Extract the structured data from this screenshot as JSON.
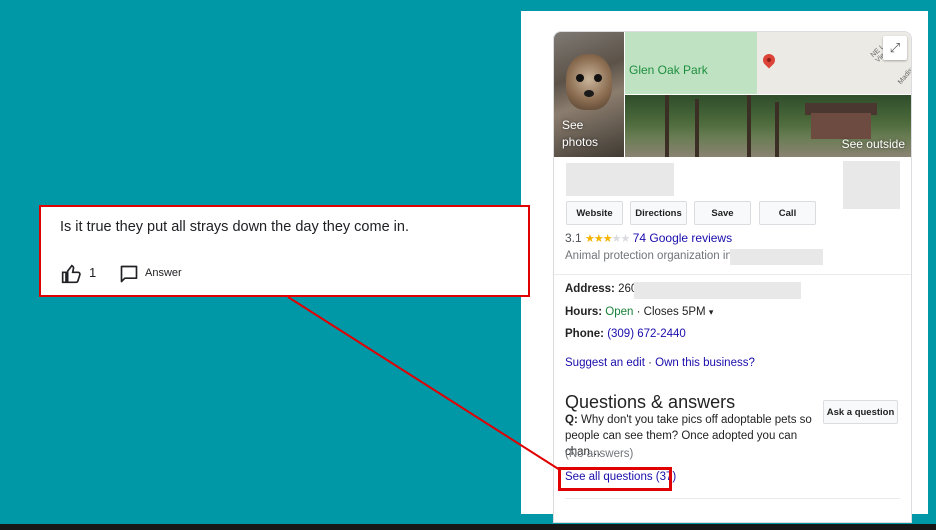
{
  "callout": {
    "question": "Is it true they put all strays down the day they come in.",
    "likes": "1",
    "answer_label": "Answer",
    "thumbs_icon": "thumbs-up-icon",
    "chat_icon": "comment-icon"
  },
  "card": {
    "see_photos": "See photos",
    "map_park_label": "Glen Oak Park",
    "street_a": "NE Lake View Ave",
    "street_b": "Madison",
    "see_outside": "See outside",
    "buttons": [
      "Website",
      "Directions",
      "Save",
      "Call"
    ],
    "rating_value": "3.1",
    "rating_stars": 3,
    "reviews_link": "74 Google reviews",
    "category": "Animal protection organization in",
    "address_label": "Address:",
    "address_value": "2600",
    "hours_label": "Hours:",
    "hours_status": "Open",
    "hours_sep": " · ",
    "hours_close": "Closes 5PM",
    "phone_label": "Phone:",
    "phone_value": "(309) 672-2440",
    "suggest_edit": "Suggest an edit",
    "dot": " · ",
    "own_business": "Own this business?",
    "qa_title": "Questions & answers",
    "q_prefix": "Q:",
    "q_text": "Why don't you take pics off adoptable pets so people can see them? Once adopted you can chan…",
    "ask_question": "Ask a question",
    "no_answers": "(No answers)",
    "see_all": "See all questions (37)"
  },
  "colors": {
    "background": "#0097a7",
    "highlight": "#e00000",
    "link": "#1a0dab",
    "open": "#188038",
    "star": "#f4b400"
  }
}
